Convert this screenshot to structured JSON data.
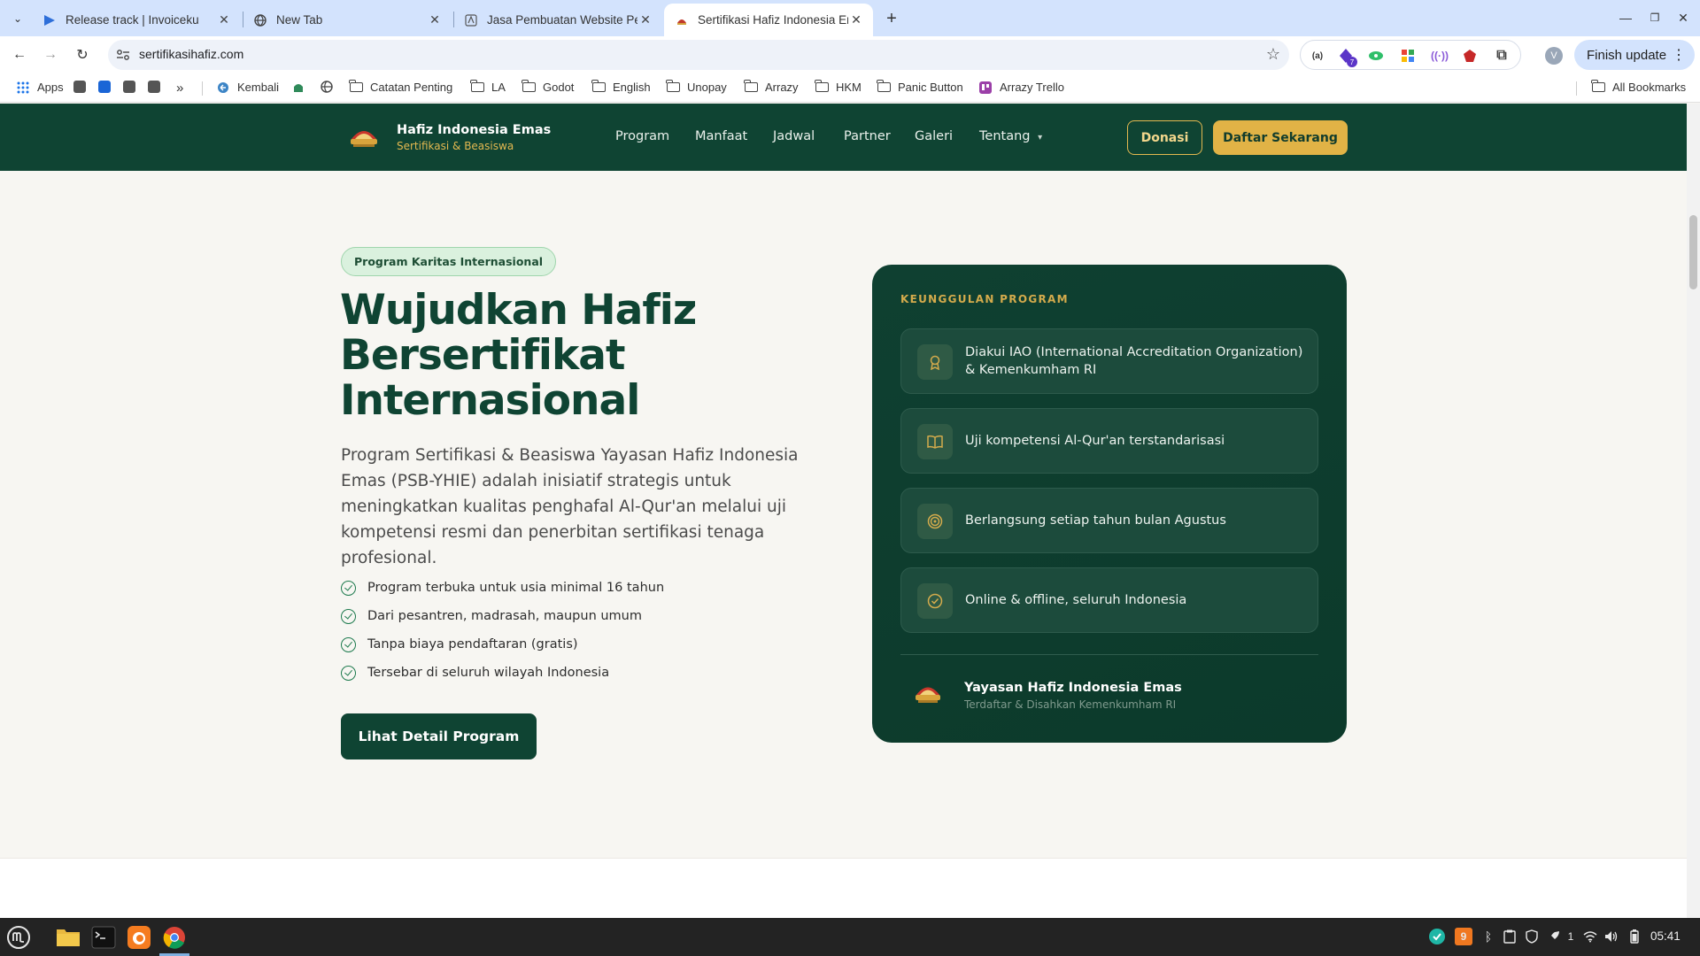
{
  "browser": {
    "tabs": [
      {
        "title": "Release track | Invoiceku",
        "active": false
      },
      {
        "title": "New Tab",
        "active": false
      },
      {
        "title": "Jasa Pembuatan Website Pe",
        "active": false
      },
      {
        "title": "Sertifikasi Hafiz Indonesia Er",
        "active": true
      }
    ],
    "url": "sertifikasihafiz.com",
    "profile_initial": "V",
    "extension_badge": "7",
    "finish_update": "Finish update",
    "bookmarks": {
      "apps": "Apps",
      "kembali": "Kembali",
      "catatan": "Catatan Penting",
      "la": "LA",
      "godot": "Godot",
      "english": "English",
      "unopay": "Unopay",
      "arrazy": "Arrazy",
      "hkm": "HKM",
      "panic": "Panic Button",
      "trello": "Arrazy Trello",
      "all": "All Bookmarks"
    }
  },
  "site": {
    "brand_title": "Hafiz Indonesia Emas",
    "brand_subtitle": "Sertifikasi & Beasiswa",
    "nav": [
      "Program",
      "Manfaat",
      "Jadwal",
      "Partner",
      "Galeri",
      "Tentang"
    ],
    "nav_dropdown_caret": "▾",
    "donasi_label": "Donasi",
    "daftar_label": "Daftar Sekarang",
    "colors": {
      "primary": "#0f4433",
      "gold": "#e1b346"
    }
  },
  "hero": {
    "badge": "Program Karitas Internasional",
    "title_lines": [
      "Wujudkan Hafiz",
      "Bersertifikat",
      "Internasional"
    ],
    "description": "Program Sertifikasi & Beasiswa Yayasan Hafiz Indonesia Emas (PSB-YHIE) adalah inisiatif strategis untuk meningkatkan kualitas penghafal Al-Qur'an melalui uji kompetensi resmi dan penerbitan sertifikasi tenaga profesional.",
    "bullets": [
      "Program terbuka untuk usia minimal 16 tahun",
      "Dari pesantren, madrasah, maupun umum",
      "Tanpa biaya pendaftaran (gratis)",
      "Tersebar di seluruh wilayah Indonesia"
    ],
    "cta": "Lihat Detail Program"
  },
  "card": {
    "heading": "KEUNGGULAN PROGRAM",
    "features": [
      {
        "icon": "award-icon",
        "text": "Diakui IAO (International Accreditation Organization) & Kemenkumham RI"
      },
      {
        "icon": "book-icon",
        "text": "Uji kompetensi Al-Qur'an terstandarisasi"
      },
      {
        "icon": "target-icon",
        "text": "Berlangsung setiap tahun bulan Agustus"
      },
      {
        "icon": "check-circle-icon",
        "text": "Online & offline, seluruh Indonesia"
      }
    ],
    "org_name": "Yayasan Hafiz Indonesia Emas",
    "org_sub": "Terdaftar & Disahkan Kemenkumham RI"
  },
  "taskbar": {
    "clock": "05:41",
    "notification_count": "9",
    "tray_count": "1"
  }
}
